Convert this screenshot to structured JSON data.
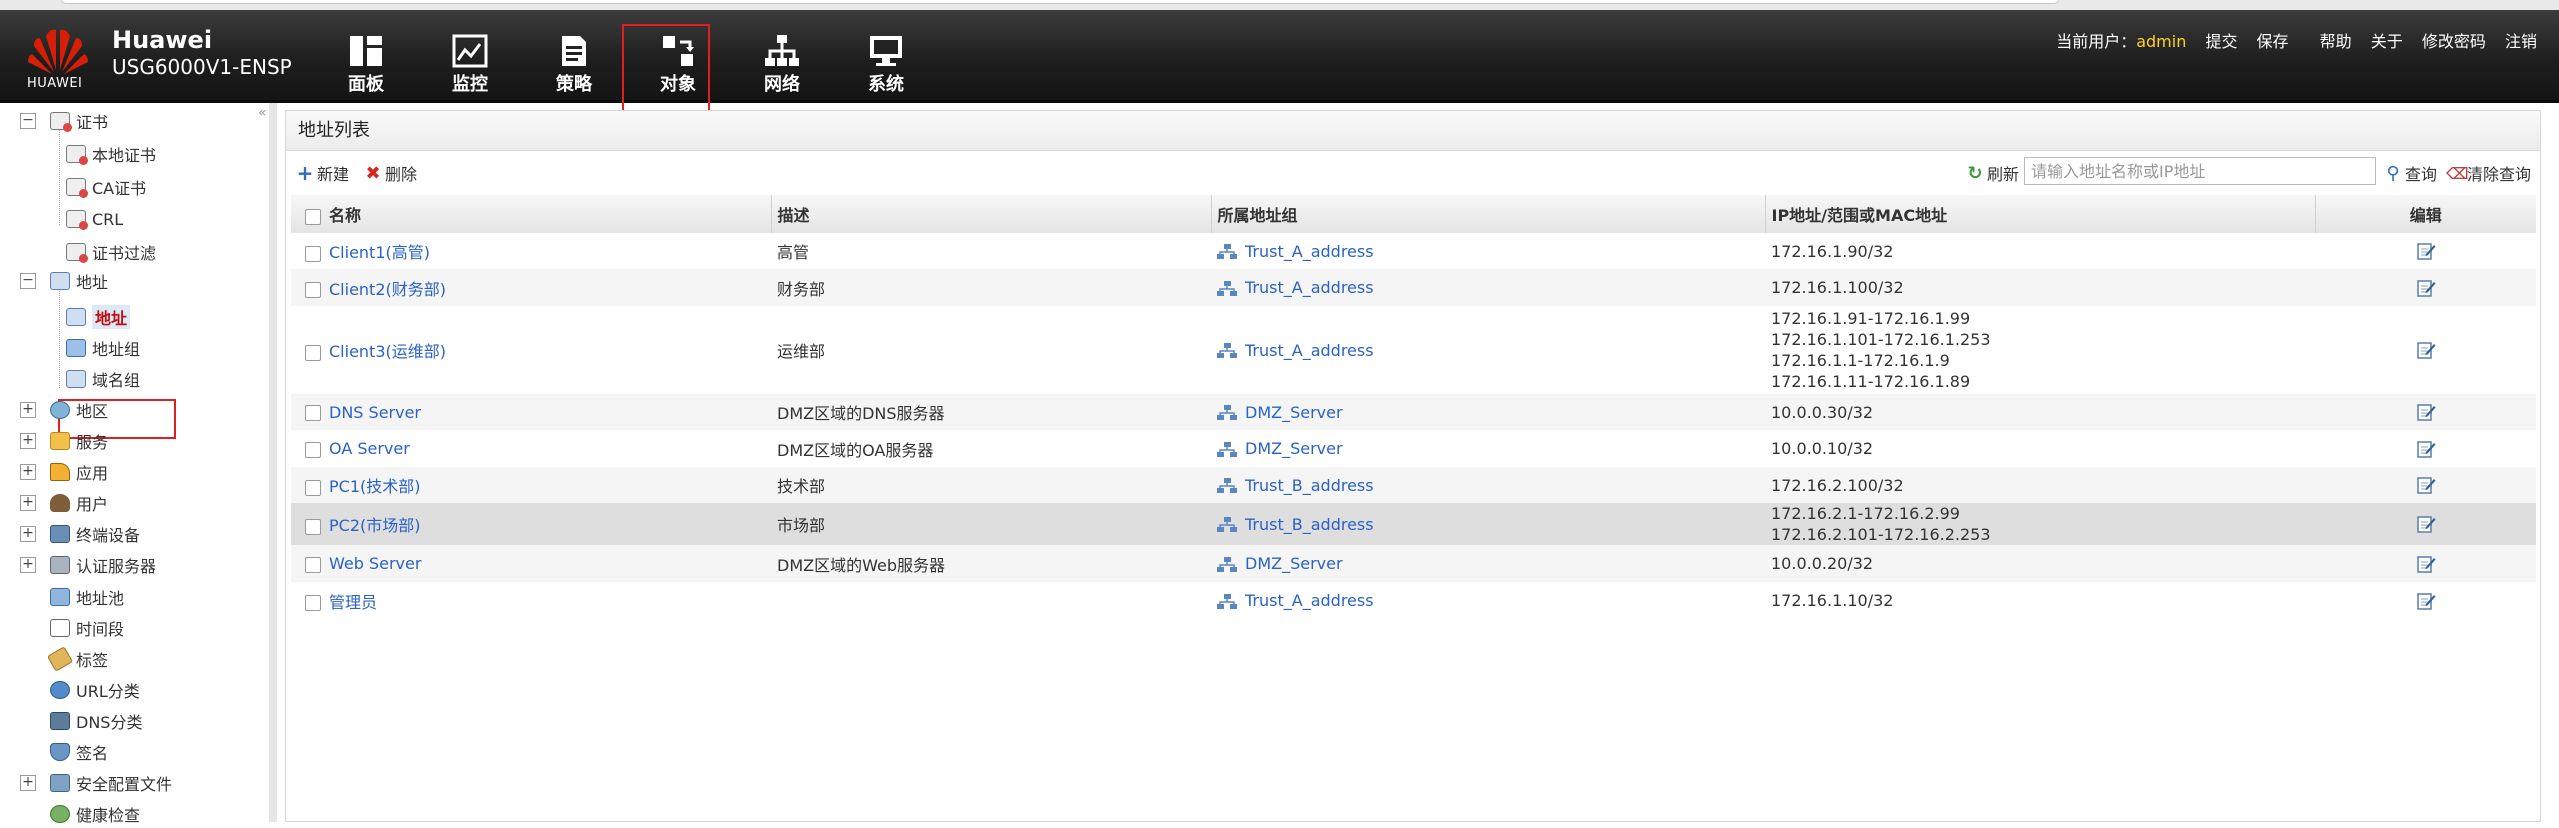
{
  "brand": {
    "logo_text": "HUAWEI",
    "title": "Huawei",
    "model": "USG6000V1-ENSP"
  },
  "nav": [
    {
      "label": "面板",
      "icon": "dashboard-icon"
    },
    {
      "label": "监控",
      "icon": "monitor-chart-icon"
    },
    {
      "label": "策略",
      "icon": "policy-document-icon"
    },
    {
      "label": "对象",
      "icon": "object-icon"
    },
    {
      "label": "网络",
      "icon": "network-topology-icon"
    },
    {
      "label": "系统",
      "icon": "system-monitor-icon"
    }
  ],
  "active_nav": "对象",
  "toplinks": {
    "current_user_label": "当前用户：",
    "user": "admin",
    "submit": "提交",
    "save": "保存",
    "help": "帮助",
    "about": "关于",
    "change_password": "修改密码",
    "logout": "注销"
  },
  "sidebar": {
    "collapse_glyph": "«",
    "items": [
      {
        "label": "证书",
        "expand": "−"
      },
      {
        "label": "本地证书"
      },
      {
        "label": "CA证书"
      },
      {
        "label": "CRL"
      },
      {
        "label": "证书过滤"
      },
      {
        "label": "地址",
        "expand": "−"
      },
      {
        "label": "地址"
      },
      {
        "label": "地址组"
      },
      {
        "label": "域名组"
      },
      {
        "label": "地区",
        "expand": "+"
      },
      {
        "label": "服务",
        "expand": "+"
      },
      {
        "label": "应用",
        "expand": "+"
      },
      {
        "label": "用户",
        "expand": "+"
      },
      {
        "label": "终端设备",
        "expand": "+"
      },
      {
        "label": "认证服务器",
        "expand": "+"
      },
      {
        "label": "地址池"
      },
      {
        "label": "时间段"
      },
      {
        "label": "标签"
      },
      {
        "label": "URL分类"
      },
      {
        "label": "DNS分类"
      },
      {
        "label": "签名"
      },
      {
        "label": "安全配置文件",
        "expand": "+"
      },
      {
        "label": "健康检查"
      }
    ],
    "selected": "地址"
  },
  "panel": {
    "title": "地址列表",
    "toolbar": {
      "new": "新建",
      "delete": "删除",
      "refresh": "刷新",
      "search_placeholder": "请输入地址名称或IP地址",
      "search": "查询",
      "clear_search": "清除查询"
    },
    "columns": [
      "名称",
      "描述",
      "所属地址组",
      "IP地址/范围或MAC地址",
      "编辑"
    ],
    "rows": [
      {
        "name": "Client1(高管)",
        "desc": "高管",
        "group": "Trust_A_address",
        "ip": [
          "172.16.1.90/32"
        ]
      },
      {
        "name": "Client2(财务部)",
        "desc": "财务部",
        "group": "Trust_A_address",
        "ip": [
          "172.16.1.100/32"
        ]
      },
      {
        "name": "Client3(运维部)",
        "desc": "运维部",
        "group": "Trust_A_address",
        "ip": [
          "172.16.1.91-172.16.1.99",
          "172.16.1.101-172.16.1.253",
          "172.16.1.1-172.16.1.9",
          "172.16.1.11-172.16.1.89"
        ]
      },
      {
        "name": "DNS Server",
        "desc": "DMZ区域的DNS服务器",
        "group": "DMZ_Server",
        "ip": [
          "10.0.0.30/32"
        ]
      },
      {
        "name": "OA Server",
        "desc": "DMZ区域的OA服务器",
        "group": "DMZ_Server",
        "ip": [
          "10.0.0.10/32"
        ]
      },
      {
        "name": "PC1(技术部)",
        "desc": "技术部",
        "group": "Trust_B_address",
        "ip": [
          "172.16.2.100/32"
        ]
      },
      {
        "name": "PC2(市场部)",
        "desc": "市场部",
        "group": "Trust_B_address",
        "ip": [
          "172.16.2.1-172.16.2.99",
          "172.16.2.101-172.16.2.253"
        ]
      },
      {
        "name": "Web Server",
        "desc": "DMZ区域的Web服务器",
        "group": "DMZ_Server",
        "ip": [
          "10.0.0.20/32"
        ]
      },
      {
        "name": "管理员",
        "desc": "",
        "group": "Trust_A_address",
        "ip": [
          "172.16.1.10/32"
        ]
      }
    ],
    "highlighted_row": 6
  },
  "colors": {
    "accent_link": "#2a62c9",
    "highlight_border": "#e02020",
    "user_name": "#ffd21f",
    "header_bg": "#1f1f1f"
  }
}
